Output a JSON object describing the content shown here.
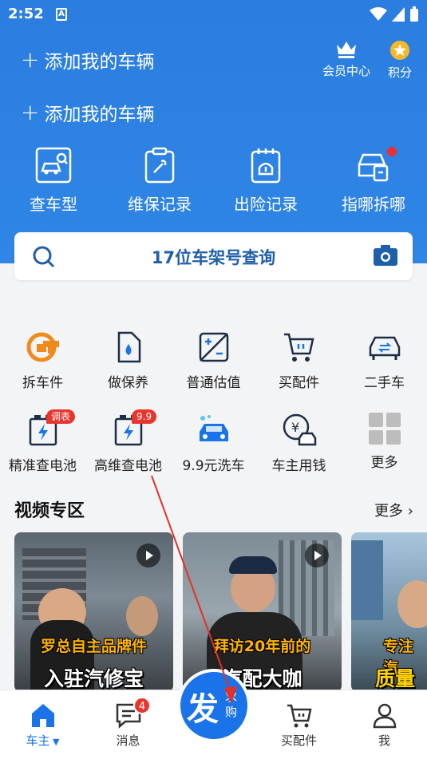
{
  "status": {
    "time": "2:52",
    "a_badge": "A"
  },
  "header": {
    "add_vehicle_1": "添加我的车辆",
    "add_vehicle_2": "添加我的车辆",
    "vip_center": "会员中心",
    "points": "积分",
    "tools": [
      {
        "label": "查车型",
        "icon": "car-search-icon"
      },
      {
        "label": "维保记录",
        "icon": "maintenance-clipboard-icon"
      },
      {
        "label": "出险记录",
        "icon": "accident-record-icon"
      },
      {
        "label": "指哪拆哪",
        "icon": "car-repair-icon"
      }
    ]
  },
  "search": {
    "placeholder": "17位车架号查询"
  },
  "grid": {
    "items": [
      {
        "label": "拆车件",
        "icon": "dismantle-parts-icon"
      },
      {
        "label": "做保养",
        "icon": "oil-maintenance-icon"
      },
      {
        "label": "普通估值",
        "icon": "valuation-icon"
      },
      {
        "label": "买配件",
        "icon": "cart-icon"
      },
      {
        "label": "二手车",
        "icon": "used-car-icon"
      },
      {
        "label": "精准查电池",
        "icon": "battery-icon",
        "badge": "调表"
      },
      {
        "label": "高维查电池",
        "icon": "battery-icon",
        "badge": "9.9"
      },
      {
        "label": "9.9元洗车",
        "icon": "car-wash-icon"
      },
      {
        "label": "车主用钱",
        "icon": "loan-icon"
      },
      {
        "label": "更多",
        "icon": "more-grid-icon"
      }
    ]
  },
  "videos": {
    "title": "视频专区",
    "more": "更多",
    "cards": [
      {
        "caption_top": "罗总自主品牌件",
        "caption_bottom": "入驻汽修宝"
      },
      {
        "caption_top": "拜访20年前的",
        "caption_bottom": "汽配大咖"
      },
      {
        "caption_top": "专注汽",
        "caption_bottom": "质量有"
      }
    ]
  },
  "tabbar": {
    "home": "车主",
    "messages": "消息",
    "messages_count": "4",
    "fab_big": "发",
    "fab_small": "求购",
    "buy_parts": "买配件",
    "me": "我"
  },
  "colors": {
    "primary": "#1a73e8",
    "header": "#2f86e6",
    "badge": "#e8352e",
    "orange": "#f08a1d"
  }
}
